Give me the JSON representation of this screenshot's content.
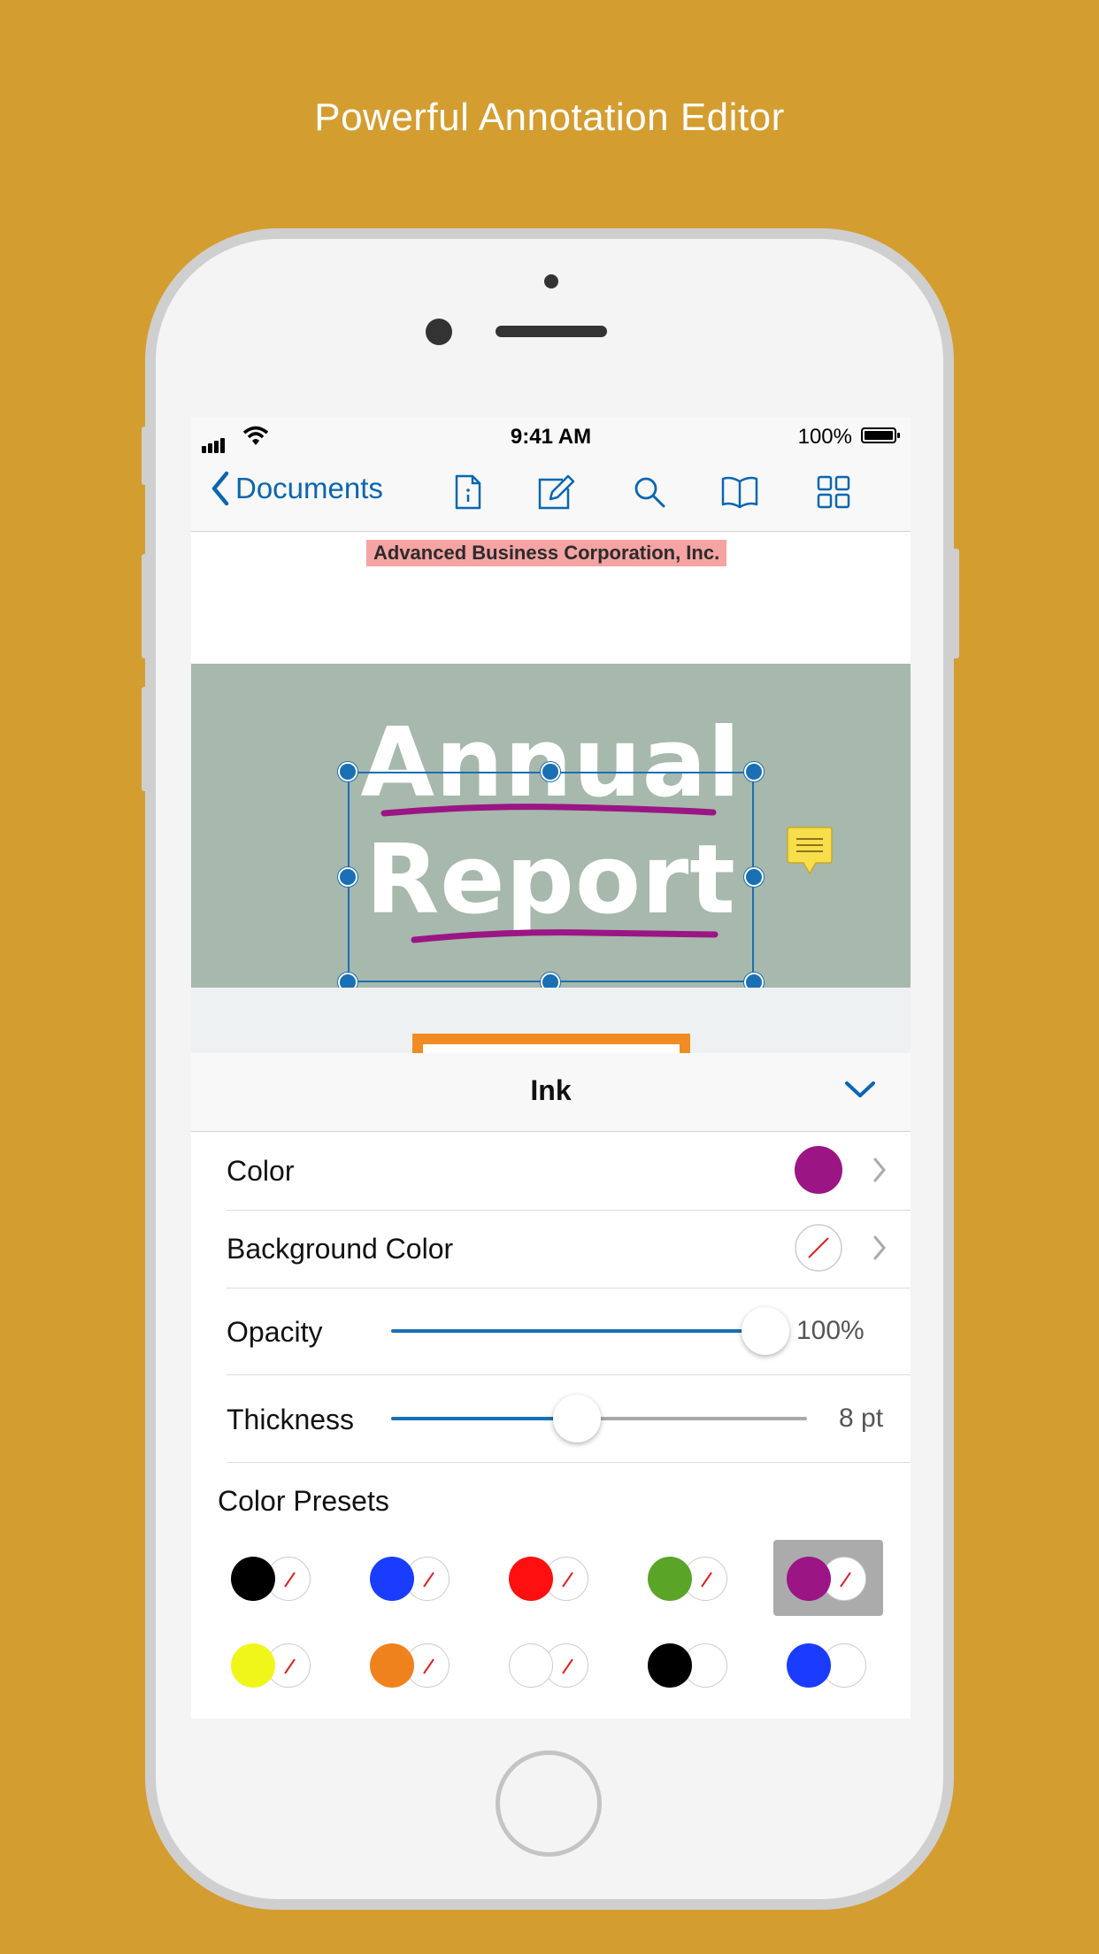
{
  "headline": "Powerful Annotation Editor",
  "status_bar": {
    "time": "9:41 AM",
    "battery": "100%"
  },
  "toolbar": {
    "back_label": "Documents",
    "icons": [
      "document-info-icon",
      "edit-pen-icon",
      "search-icon",
      "book-icon",
      "grid-icon"
    ]
  },
  "document": {
    "company": "Advanced Business Corporation, Inc.",
    "title_line1": "Annual",
    "title_line2": "Report"
  },
  "panel": {
    "title": "Ink",
    "rows": {
      "color": {
        "label": "Color",
        "value_color": "#9b1585"
      },
      "background": {
        "label": "Background Color"
      },
      "opacity": {
        "label": "Opacity",
        "value": "100%",
        "level": 1.0
      },
      "thickness": {
        "label": "Thickness",
        "value": "8 pt",
        "level": 0.44
      }
    },
    "presets_label": "Color Presets",
    "presets": [
      {
        "color": "#000000",
        "fill": "none"
      },
      {
        "color": "#1a3cff",
        "fill": "none"
      },
      {
        "color": "#ff0f0f",
        "fill": "none"
      },
      {
        "color": "#5aa528",
        "fill": "none"
      },
      {
        "color": "#9b1585",
        "fill": "none",
        "selected": true
      },
      {
        "color": "#f0f51a",
        "fill": "none"
      },
      {
        "color": "#f0821e",
        "fill": "none"
      },
      {
        "color": "#ffffff",
        "fill": "none"
      },
      {
        "color": "#000000",
        "fill": "white"
      },
      {
        "color": "#1a3cff",
        "fill": "white"
      }
    ]
  },
  "colors": {
    "background": "#d49d30",
    "accent": "#0b66b0",
    "highlight": "#f5a3a3",
    "ink": "#9b1585",
    "cover": "#a7b8ad"
  }
}
